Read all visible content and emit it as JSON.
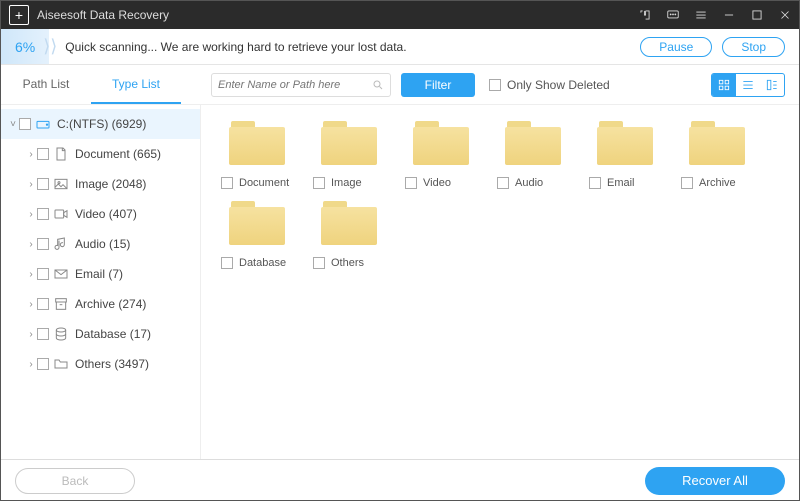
{
  "app": {
    "title": "Aiseesoft Data Recovery"
  },
  "progress": {
    "percent": "6%",
    "message": "Quick scanning... We are working hard to retrieve your lost data.",
    "pause": "Pause",
    "stop": "Stop"
  },
  "tabs": {
    "path": "Path List",
    "type": "Type List"
  },
  "search": {
    "placeholder": "Enter Name or Path here"
  },
  "filter": "Filter",
  "only_show_deleted": "Only Show Deleted",
  "sidebar": {
    "root": "C:(NTFS) (6929)",
    "items": [
      {
        "label": "Document (665)"
      },
      {
        "label": "Image (2048)"
      },
      {
        "label": "Video (407)"
      },
      {
        "label": "Audio (15)"
      },
      {
        "label": "Email (7)"
      },
      {
        "label": "Archive (274)"
      },
      {
        "label": "Database (17)"
      },
      {
        "label": "Others (3497)"
      }
    ]
  },
  "folders": [
    {
      "label": "Document"
    },
    {
      "label": "Image"
    },
    {
      "label": "Video"
    },
    {
      "label": "Audio"
    },
    {
      "label": "Email"
    },
    {
      "label": "Archive"
    },
    {
      "label": "Database"
    },
    {
      "label": "Others"
    }
  ],
  "footer": {
    "back": "Back",
    "recover": "Recover All"
  }
}
